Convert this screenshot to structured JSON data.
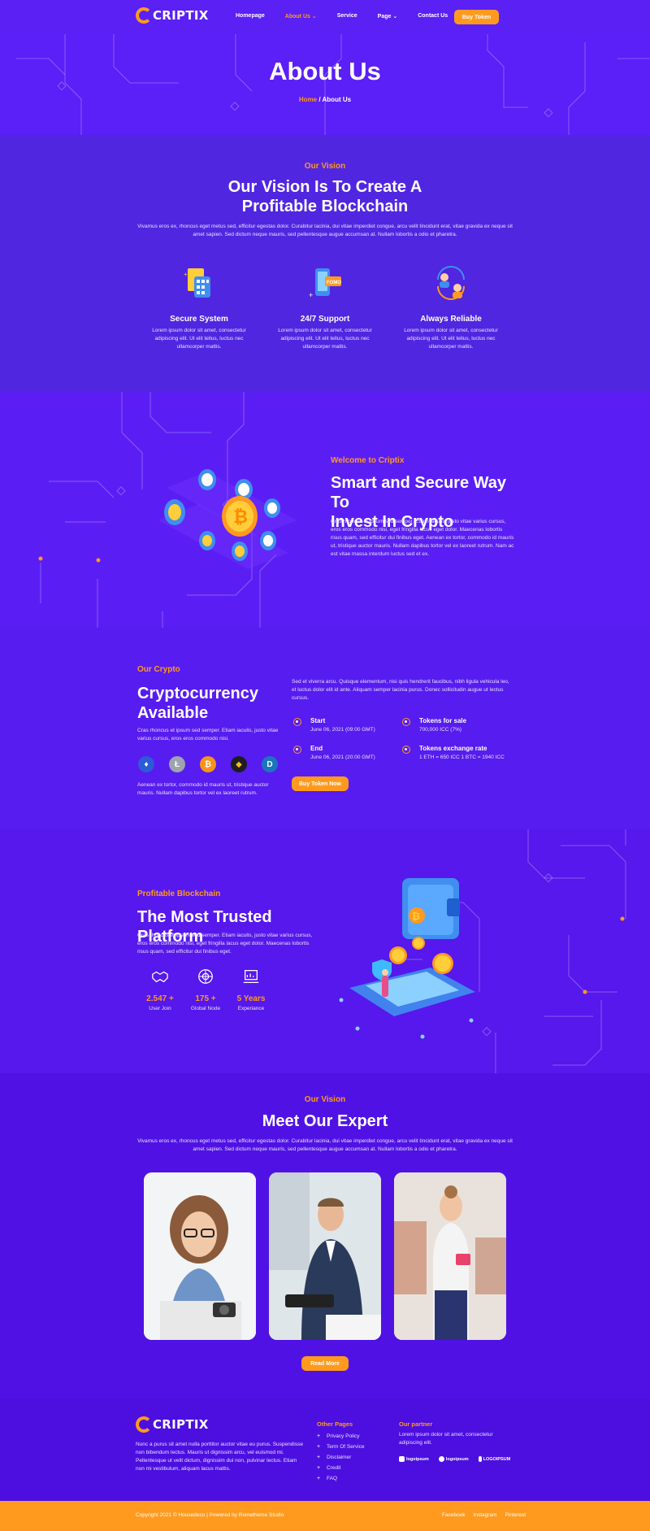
{
  "brand": {
    "name": "CRIPTIX",
    "accent": "#ff9a1f",
    "primary": "#5a1ef5"
  },
  "nav": {
    "items": [
      "Homepage",
      "About Us",
      "Service",
      "Page",
      "Contact Us"
    ],
    "buy_token": "Buy Token"
  },
  "hero": {
    "title": "About Us",
    "crumb_home": "Home",
    "crumb_sep": " / ",
    "crumb_current": "About Us"
  },
  "vision": {
    "eyebrow": "Our Vision",
    "title_line1": "Our Vision Is To Create A",
    "title_line2": "Profitable Blockchain",
    "text": "Vivamus eros ex, rhoncus eget metus sed, efficitur egestas dolor. Curabitur lacinia, dui vitae imperdiet congue, arcu velit tincidunt erat, vitae gravida ex neque sit amet sapien. Sed dictum neque mauris, sed pellentesque augue accumsan at. Nullam lobortis a odio et pharetra.",
    "features": [
      {
        "title": "Secure System",
        "text": "Lorem ipsum dolor sit amet, consectetur adipiscing elit. Ut elit tellus, luctus nec ullamcorper mattis.",
        "icon": "secure-system-icon"
      },
      {
        "title": "24/7 Support",
        "text": "Lorem ipsum dolor sit amet, consectetur adipiscing elit. Ut elit tellus, luctus nec ullamcorper mattis.",
        "icon": "support-icon"
      },
      {
        "title": "Always Reliable",
        "text": "Lorem ipsum dolor sit amet, consectetur adipiscing elit. Ut elit tellus, luctus nec ullamcorper mattis.",
        "icon": "reliable-icon"
      }
    ]
  },
  "welcome": {
    "eyebrow": "Welcome to Criptix",
    "title_line1": "Smart and Secure Way To",
    "title_line2": "Invest In Crypto",
    "text": "Cras rhoncus et ipsum sed semper. Etiam iaculis, justo vitae varius cursus, eros eros commodo nisi, eget fringilla lacus eget dolor. Maecenas lobortis risus quam, sed efficitur dui finibus eget. Aenean ex tortor, commodo id mauris ut, tristique auctor mauris. Nullam dapibus tortor vel ex laoreet rutrum. Nam ac est vitae massa interdum luctus sed et ex."
  },
  "crypto": {
    "eyebrow": "Our Crypto",
    "title_line1": "Cryptocurrency",
    "title_line2": "Available",
    "text1": "Cras rhoncus et ipsum sed semper. Etiam iaculis, justo vitae varius cursus, eros eros commodo nisi.",
    "text2": "Aenean ex tortor, commodo id mauris ut, tristique auctor mauris. Nullam dapibus tortor vel ex laoreet rutrum.",
    "text3": "Sed et viverra arcu. Quisque elementum, nisi quis hendrerit faucibus, nibh ligula vehicula leo, et luctus dolor elit id ante. Aliquam semper lacinia purus. Donec sollicitudin augue ut lectus cursus.",
    "coins": [
      {
        "name": "ethereum-coin-icon",
        "color": "#2b5bd7",
        "glyph": "♦"
      },
      {
        "name": "litecoin-coin-icon",
        "color": "#9ea3ad",
        "glyph": "Ł"
      },
      {
        "name": "bitcoin-coin-icon",
        "color": "#f7931a",
        "glyph": "₿"
      },
      {
        "name": "binance-coin-icon",
        "color": "#1e1e1e",
        "glyph": "◆"
      },
      {
        "name": "dash-coin-icon",
        "color": "#1c75bc",
        "glyph": "D"
      }
    ],
    "ico": [
      {
        "label": "Start",
        "value": "June 06, 2021 (09:00 GMT)"
      },
      {
        "label": "End",
        "value": "June 06, 2021 (20:00 GMT)"
      },
      {
        "label": "Tokens for sale",
        "value": "700,000 ICC (7%)"
      },
      {
        "label": "Tokens exchange rate",
        "value": "1 ETH = 650 ICC 1 BTC = 1940 ICC"
      }
    ],
    "buy_now": "Buy Token Now"
  },
  "platform": {
    "eyebrow": "Profitable Blockchain",
    "title": "The Most Trusted Platform",
    "text": "Cras rhoncus et ipsum sed semper. Etiam iaculis, justo vitae varius cursus, eros eros commodo nisi, eget fringilla lacus eget dolor. Maecenas lobortis risus quam, sed efficitur dui finibus eget.",
    "stats": [
      {
        "value": "2.547 +",
        "label": "User Join",
        "icon": "handshake-icon"
      },
      {
        "value": "175 +",
        "label": "Global Node",
        "icon": "globe-node-icon"
      },
      {
        "value": "5 Years",
        "label": "Experiance",
        "icon": "experience-chart-icon"
      }
    ]
  },
  "experts": {
    "eyebrow": "Our Vision",
    "title": "Meet Our Expert",
    "text": "Vivamus eros ex, rhoncus eget metus sed, efficitur egestas dolor. Curabitur lacinia, dui vitae imperdiet congue, arcu velit tincidunt erat, vitae gravida ex neque sit amet sapien. Sed dictum neque mauris, sed pellentesque augue accumsan at. Nullam lobortis a odio et pharetra.",
    "read_more": "Read More"
  },
  "footer": {
    "about": "Nunc a purus sit amet nulla porttitor auctor vitae eu purus. Suspendisse non bibendum lectus. Mauris ut dignissim arcu, vel euismod mi. Pellentesque ut velit dictum, dignissim dui non, pulvinar lectus. Etiam non mi vestibulum, aliquam lacus mattis.",
    "pages_title": "Other Pages",
    "pages": [
      "Privacy Policy",
      "Term Of Service",
      "Disclaimer",
      "Credit",
      "FAQ"
    ],
    "partner_title": "Our partner",
    "partner_text": "Lorem ipsum dolor sit amet, consectetur adipiscing elit.",
    "partners": [
      "logoipsum",
      "logoipsum",
      "LOGOIPSUM"
    ],
    "copyright": "Copyright 2021 © Housedeco | Powered by Rometheme Studio",
    "social": [
      "Facebook",
      "Instagram",
      "Pinterest"
    ]
  }
}
